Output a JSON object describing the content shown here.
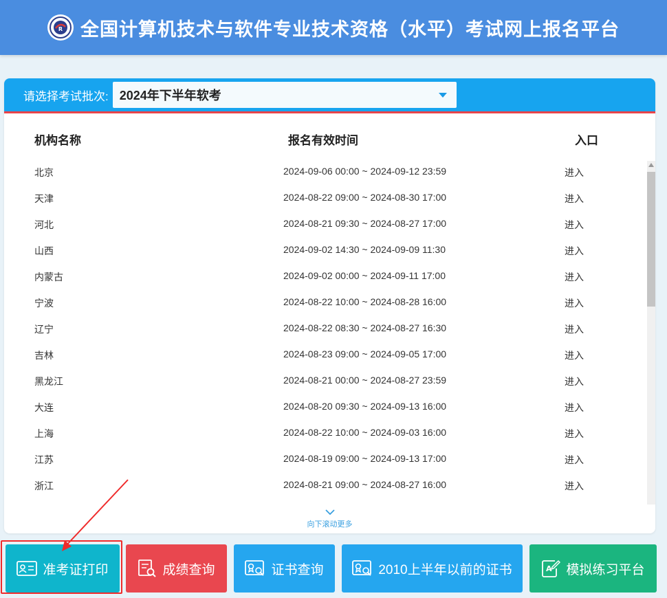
{
  "header": {
    "title": "全国计算机技术与软件专业技术资格（水平）考试网上报名平台"
  },
  "batch": {
    "label": "请选择考试批次:",
    "selected": "2024年下半年软考"
  },
  "table": {
    "headers": [
      "机构名称",
      "报名有效时间",
      "入口"
    ],
    "rows": [
      {
        "name": "北京",
        "time": "2024-09-06 00:00 ~ 2024-09-12 23:59",
        "entry": "进入"
      },
      {
        "name": "天津",
        "time": "2024-08-22 09:00 ~ 2024-08-30 17:00",
        "entry": "进入"
      },
      {
        "name": "河北",
        "time": "2024-08-21 09:30 ~ 2024-08-27 17:00",
        "entry": "进入"
      },
      {
        "name": "山西",
        "time": "2024-09-02 14:30 ~ 2024-09-09 11:30",
        "entry": "进入"
      },
      {
        "name": "内蒙古",
        "time": "2024-09-02 00:00 ~ 2024-09-11 17:00",
        "entry": "进入"
      },
      {
        "name": "宁波",
        "time": "2024-08-22 10:00 ~ 2024-08-28 16:00",
        "entry": "进入"
      },
      {
        "name": "辽宁",
        "time": "2024-08-22 08:30 ~ 2024-08-27 16:30",
        "entry": "进入"
      },
      {
        "name": "吉林",
        "time": "2024-08-23 09:00 ~ 2024-09-05 17:00",
        "entry": "进入"
      },
      {
        "name": "黑龙江",
        "time": "2024-08-21 00:00 ~ 2024-08-27 23:59",
        "entry": "进入"
      },
      {
        "name": "大连",
        "time": "2024-08-20 09:30 ~ 2024-09-13 16:00",
        "entry": "进入"
      },
      {
        "name": "上海",
        "time": "2024-08-22 10:00 ~ 2024-09-03 16:00",
        "entry": "进入"
      },
      {
        "name": "江苏",
        "time": "2024-08-19 09:00 ~ 2024-09-13 17:00",
        "entry": "进入"
      },
      {
        "name": "浙江",
        "time": "2024-08-21 09:00 ~ 2024-08-27 16:00",
        "entry": "进入"
      }
    ]
  },
  "scroll_more": "向下滚动更多",
  "buttons": {
    "admit_ticket": "准考证打印",
    "score_query": "成绩查询",
    "cert_query": "证书查询",
    "old_cert": "2010上半年以前的证书",
    "practice": "模拟练习平台"
  },
  "colors": {
    "header_bg": "#4a8de0",
    "panel_top": "#17a4ef",
    "accent_red": "#e8444a",
    "btn_cyan": "#0fb5cc",
    "btn_red": "#e9474f",
    "btn_blue": "#25a6ef",
    "btn_green": "#1bb57f",
    "highlight": "#ef2b2b"
  },
  "icons": [
    "logo-icon",
    "chevron-down-icon",
    "id-card-icon",
    "score-doc-icon",
    "certificate-icon",
    "edit-practice-icon"
  ]
}
